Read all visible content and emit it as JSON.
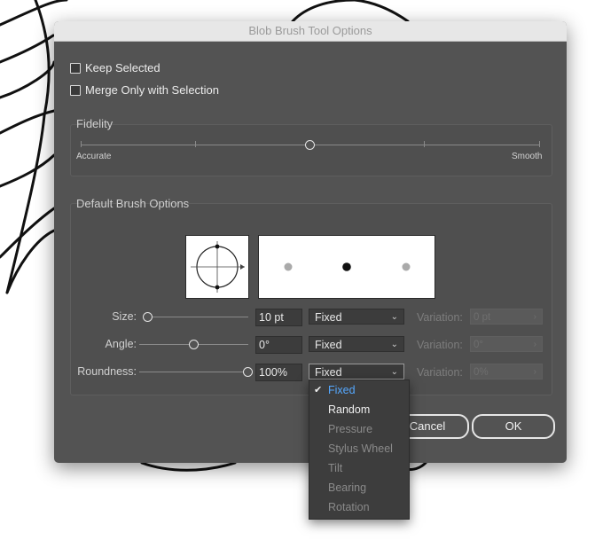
{
  "dialog": {
    "title": "Blob Brush Tool Options",
    "keep_selected_label": "Keep Selected",
    "merge_only_label": "Merge Only with Selection",
    "fidelity": {
      "title": "Fidelity",
      "left_label": "Accurate",
      "right_label": "Smooth",
      "value_fraction": 0.5
    },
    "brush_options": {
      "title": "Default Brush Options",
      "size": {
        "label": "Size:",
        "value": "10 pt",
        "mode": "Fixed",
        "slider_fraction": 0.0,
        "variation_label": "Variation:",
        "variation_value": "0 pt"
      },
      "angle": {
        "label": "Angle:",
        "value": "0°",
        "mode": "Fixed",
        "slider_fraction": 0.5,
        "variation_label": "Variation:",
        "variation_value": "0°"
      },
      "roundness": {
        "label": "Roundness:",
        "value": "100%",
        "mode": "Fixed",
        "slider_fraction": 1.0,
        "variation_label": "Variation:",
        "variation_value": "0%"
      }
    },
    "buttons": {
      "cancel": "Cancel",
      "ok": "OK"
    },
    "dropdown_menu": {
      "items": [
        {
          "label": "Fixed",
          "state": "selected"
        },
        {
          "label": "Random",
          "state": "enabled"
        },
        {
          "label": "Pressure",
          "state": "disabled"
        },
        {
          "label": "Stylus Wheel",
          "state": "disabled"
        },
        {
          "label": "Tilt",
          "state": "disabled"
        },
        {
          "label": "Bearing",
          "state": "disabled"
        },
        {
          "label": "Rotation",
          "state": "disabled"
        }
      ]
    }
  },
  "colors": {
    "dialog_bg": "#535353",
    "accent_selected": "#55a8ff"
  },
  "icons": {
    "chevron": "chevron-down-icon",
    "check": "checkmark-icon"
  }
}
